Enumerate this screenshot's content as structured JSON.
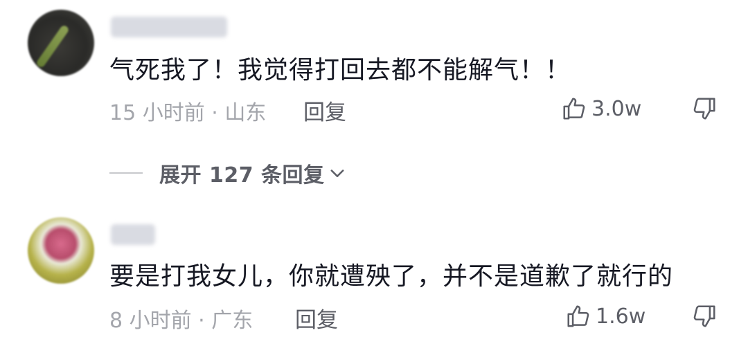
{
  "comments": [
    {
      "text": "气死我了！我觉得打回去都不能解气！！",
      "meta": "15 小时前 · 山东",
      "reply_label": "回复",
      "likes": "3.0w"
    },
    {
      "text": "要是打我女儿，你就遭殃了，并不是道歉了就行的",
      "meta": "8 小时前 · 广东",
      "reply_label": "回复",
      "likes": "1.6w"
    }
  ],
  "expand_replies": {
    "label": "展开 127 条回复"
  },
  "icons": {
    "like": "thumbs-up-icon",
    "dislike": "thumbs-down-icon",
    "expand": "chevron-down-icon"
  },
  "colors": {
    "text_primary": "#161823",
    "text_meta": "#a3a5ab",
    "text_action": "#5c5e66"
  }
}
